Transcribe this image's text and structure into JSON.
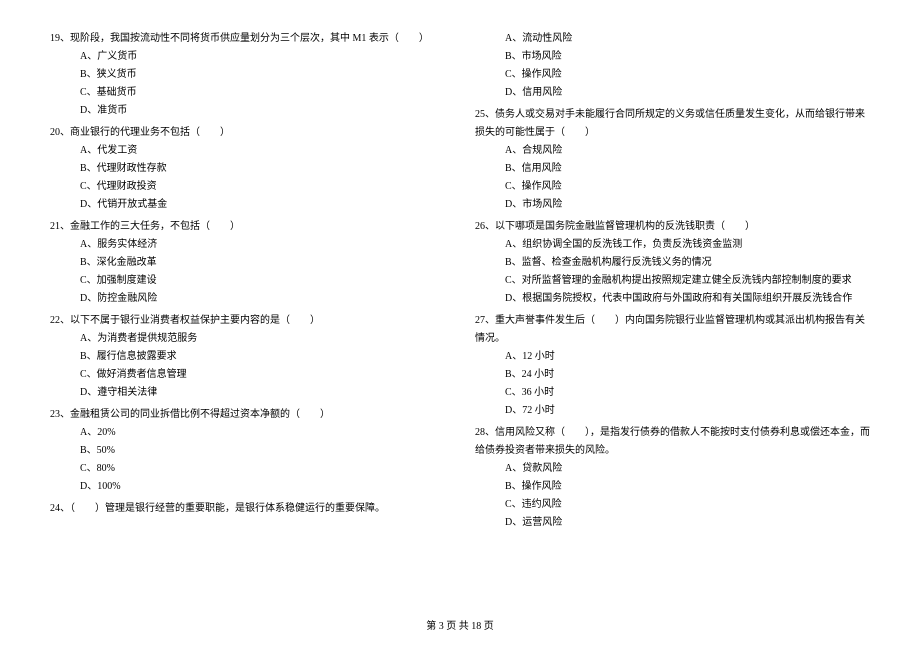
{
  "left_column": {
    "q19": {
      "text": "19、现阶段，我国按流动性不同将货币供应量划分为三个层次，其中 M1 表示（　　）",
      "options": [
        "A、广义货币",
        "B、狭义货币",
        "C、基础货币",
        "D、准货币"
      ]
    },
    "q20": {
      "text": "20、商业银行的代理业务不包括（　　）",
      "options": [
        "A、代发工资",
        "B、代理财政性存款",
        "C、代理财政投资",
        "D、代销开放式基金"
      ]
    },
    "q21": {
      "text": "21、金融工作的三大任务，不包括（　　）",
      "options": [
        "A、服务实体经济",
        "B、深化金融改革",
        "C、加强制度建设",
        "D、防控金融风险"
      ]
    },
    "q22": {
      "text": "22、以下不属于银行业消费者权益保护主要内容的是（　　）",
      "options": [
        "A、为消费者提供规范服务",
        "B、履行信息披露要求",
        "C、做好消费者信息管理",
        "D、遵守相关法律"
      ]
    },
    "q23": {
      "text": "23、金融租赁公司的同业拆借比例不得超过资本净额的（　　）",
      "options": [
        "A、20%",
        "B、50%",
        "C、80%",
        "D、100%"
      ]
    },
    "q24": {
      "text": "24、（　　）管理是银行经营的重要职能，是银行体系稳健运行的重要保障。"
    }
  },
  "right_column": {
    "q24_options": [
      "A、流动性风险",
      "B、市场风险",
      "C、操作风险",
      "D、信用风险"
    ],
    "q25": {
      "text": "25、债务人或交易对手未能履行合同所规定的义务或信任质量发生变化，从而给银行带来损失的可能性属于（　　）",
      "options": [
        "A、合规风险",
        "B、信用风险",
        "C、操作风险",
        "D、市场风险"
      ]
    },
    "q26": {
      "text": "26、以下哪项是国务院金融监督管理机构的反洗钱职责（　　）",
      "options": [
        "A、组织协调全国的反洗钱工作，负责反洗钱资金监测",
        "B、监督、检查金融机构履行反洗钱义务的情况",
        "C、对所监督管理的金融机构提出按照规定建立健全反洗钱内部控制制度的要求",
        "D、根据国务院授权，代表中国政府与外国政府和有关国际组织开展反洗钱合作"
      ]
    },
    "q27": {
      "text": "27、重大声誉事件发生后（　　）内向国务院银行业监督管理机构或其派出机构报告有关情况。",
      "options": [
        "A、12 小时",
        "B、24 小时",
        "C、36 小时",
        "D、72 小时"
      ]
    },
    "q28": {
      "text": "28、信用风险又称（　　），是指发行债券的借款人不能按时支付债券利息或偿还本金，而给债券投资者带来损失的风险。",
      "options": [
        "A、贷款风险",
        "B、操作风险",
        "C、违约风险",
        "D、运营风险"
      ]
    }
  },
  "footer": "第 3 页 共 18 页"
}
